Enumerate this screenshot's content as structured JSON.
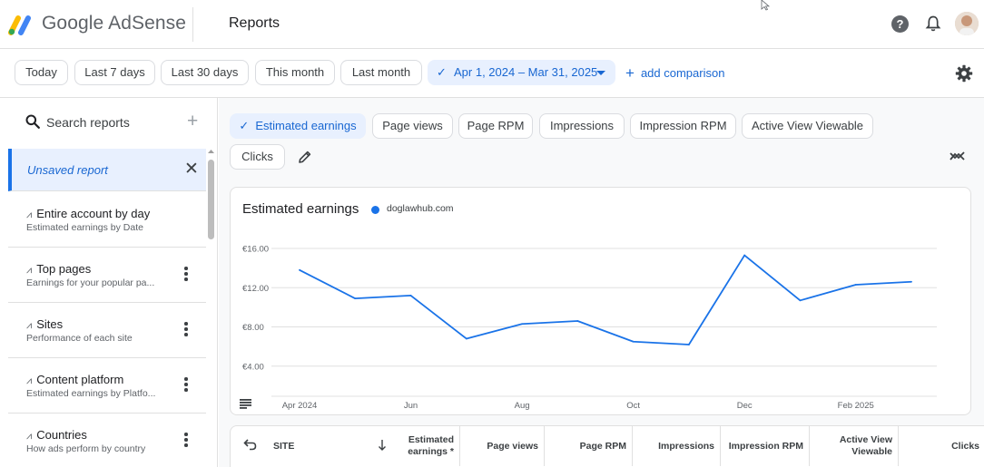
{
  "app": {
    "brand_google": "Google",
    "brand_product": "AdSense",
    "page_title": "Reports",
    "help_glyph": "?"
  },
  "date_filters": [
    "Today",
    "Last 7 days",
    "Last 30 days",
    "This month",
    "Last month"
  ],
  "date_range": {
    "label": "Apr 1, 2024 – Mar 31, 2025",
    "selected": true
  },
  "add_comparison": "add comparison",
  "sidebar": {
    "search_placeholder": "Search reports",
    "unsaved_label": "Unsaved report",
    "items": [
      {
        "title": "Entire account by day",
        "subtitle": "Estimated earnings by Date"
      },
      {
        "title": "Top pages",
        "subtitle": "Earnings for your popular pa..."
      },
      {
        "title": "Sites",
        "subtitle": "Performance of each site"
      },
      {
        "title": "Content platform",
        "subtitle": "Estimated earnings by Platfo..."
      },
      {
        "title": "Countries",
        "subtitle": "How ads perform by country"
      }
    ]
  },
  "metrics": [
    {
      "label": "Estimated earnings",
      "active": true
    },
    {
      "label": "Page views",
      "active": false
    },
    {
      "label": "Page RPM",
      "active": false
    },
    {
      "label": "Impressions",
      "active": false
    },
    {
      "label": "Impression RPM",
      "active": false
    },
    {
      "label": "Active View Viewable",
      "active": false
    },
    {
      "label": "Clicks",
      "active": false
    }
  ],
  "chart_data": {
    "type": "line",
    "title": "Estimated earnings",
    "series": [
      {
        "name": "doglawhub.com",
        "color": "#1a73e8",
        "values": [
          13.8,
          10.9,
          11.2,
          6.8,
          8.3,
          8.6,
          6.5,
          6.2,
          15.3,
          10.7,
          12.3,
          12.6
        ]
      }
    ],
    "x": [
      "2024-04",
      "2024-05",
      "2024-06",
      "2024-07",
      "2024-08",
      "2024-09",
      "2024-10",
      "2024-11",
      "2024-12",
      "2025-01",
      "2025-02",
      "2025-03"
    ],
    "x_tick_labels": [
      {
        "x": "2024-04",
        "label": "Apr 2024"
      },
      {
        "x": "2024-06",
        "label": "Jun"
      },
      {
        "x": "2024-08",
        "label": "Aug"
      },
      {
        "x": "2024-10",
        "label": "Oct"
      },
      {
        "x": "2024-12",
        "label": "Dec"
      },
      {
        "x": "2025-02",
        "label": "Feb 2025"
      }
    ],
    "y_ticks": [
      4,
      8,
      12,
      16
    ],
    "y_tick_labels": [
      "€4.00",
      "€8.00",
      "€12.00",
      "€16.00"
    ],
    "ylim": [
      0,
      16
    ],
    "grid": true,
    "legend": "top-left"
  },
  "table": {
    "columns": [
      {
        "label": "SITE"
      },
      {
        "label": "Estimated earnings *"
      },
      {
        "label": "Page views"
      },
      {
        "label": "Page RPM"
      },
      {
        "label": "Impressions"
      },
      {
        "label": "Impression RPM"
      },
      {
        "label": "Active View Viewable"
      },
      {
        "label": "Clicks"
      }
    ]
  }
}
